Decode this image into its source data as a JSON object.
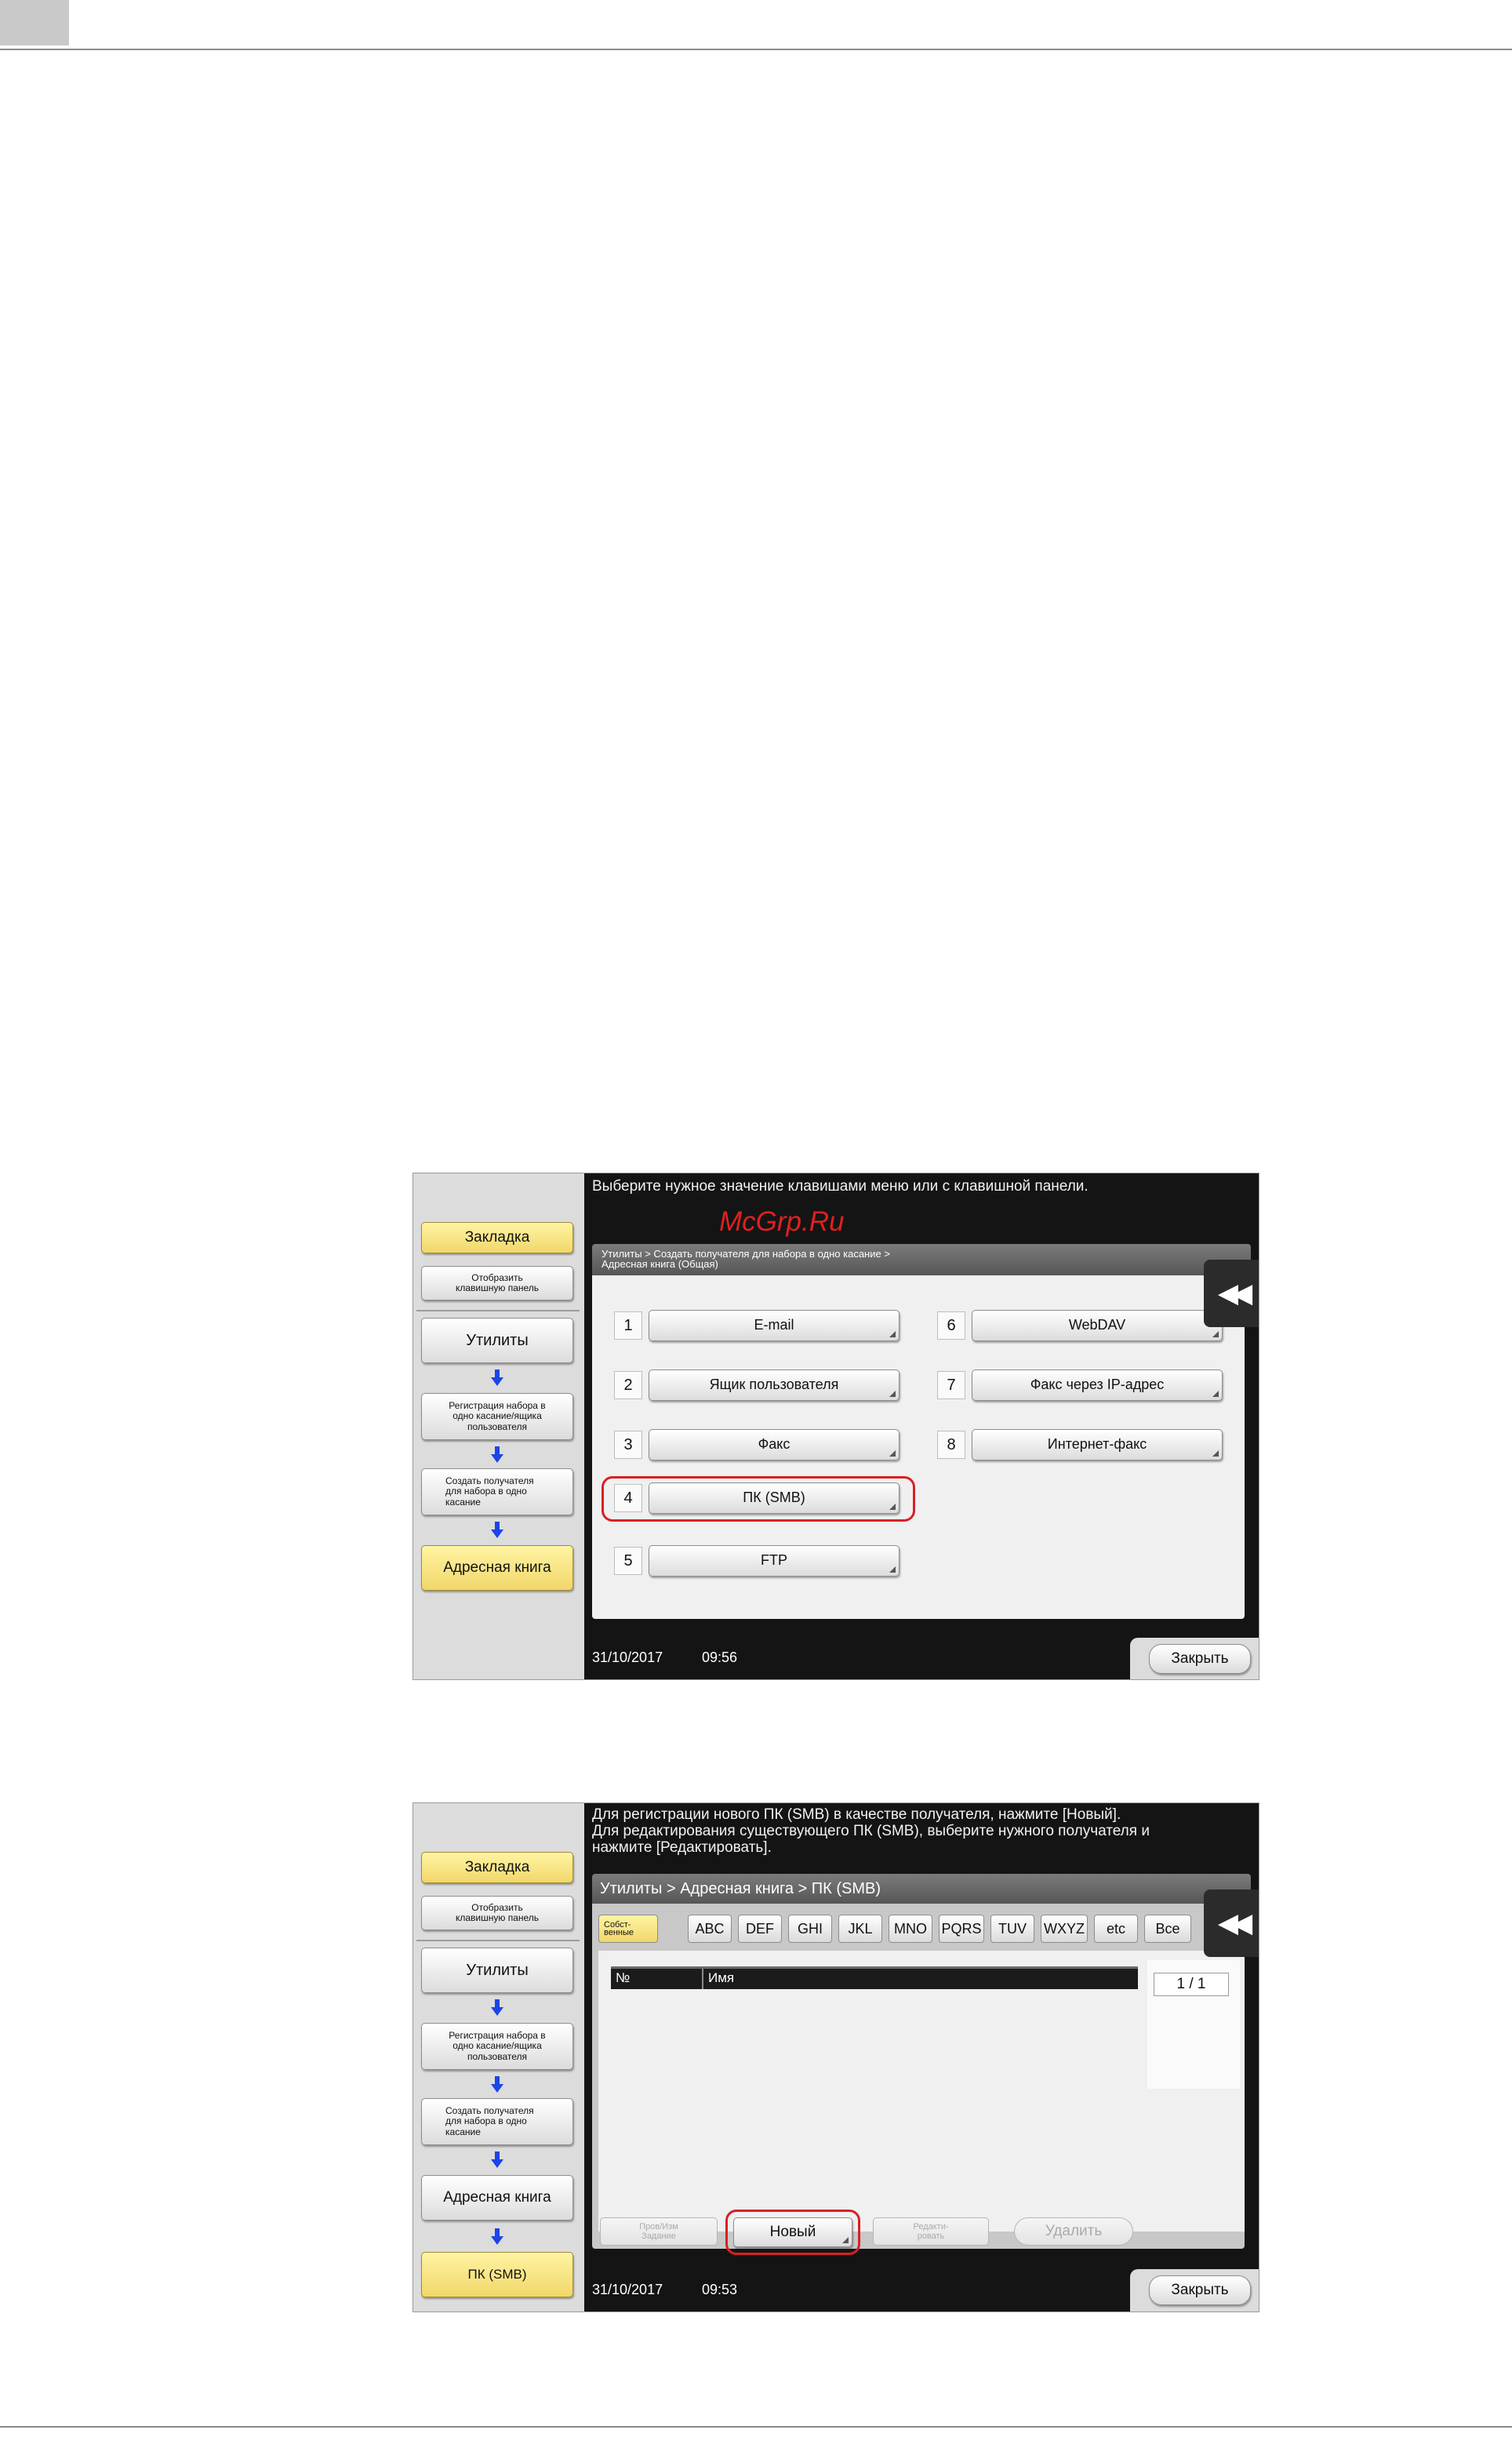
{
  "screen1": {
    "instruction": "Выберите нужное значение клавишами меню или с клавишной панели.",
    "watermark": "McGrp.Ru",
    "breadcrumb_line1": "Утилиты > Создать получателя для набора в одно касание >",
    "breadcrumb_line2": "Адресная книга (Общая)",
    "sidebar": {
      "bookmark": "Закладка",
      "show_keypad": "Отобразить клавишную панель",
      "utilities": "Утилиты",
      "one_touch_registration": "Регистрация набора в одно касание/ящика пользователя",
      "create_recipient": "Создать получателя для набора в одно касание",
      "address_book": "Адресная книга"
    },
    "items": [
      {
        "num": "1",
        "label": "E-mail"
      },
      {
        "num": "2",
        "label": "Ящик пользователя"
      },
      {
        "num": "3",
        "label": "Факс"
      },
      {
        "num": "4",
        "label": "ПК (SMB)"
      },
      {
        "num": "5",
        "label": "FTP"
      },
      {
        "num": "6",
        "label": "WebDAV"
      },
      {
        "num": "7",
        "label": "Факс через IP-адрес"
      },
      {
        "num": "8",
        "label": "Интернет-факс"
      }
    ],
    "date": "31/10/2017",
    "time": "09:56",
    "close": "Закрыть"
  },
  "screen2": {
    "instruction_line1": "Для регистрации нового ПК (SMB) в качестве получателя, нажмите [Новый].",
    "instruction_line2": "Для редактирования существующего ПК (SMB), выберите нужного получателя и",
    "instruction_line3": "нажмите [Редактировать].",
    "breadcrumb": "Утилиты > Адресная книга > ПК (SMB)",
    "sidebar": {
      "bookmark": "Закладка",
      "show_keypad": "Отобразить клавишную панель",
      "utilities": "Утилиты",
      "one_touch_registration": "Регистрация набора в одно касание/ящика пользователя",
      "create_recipient": "Создать получателя для набора в одно касание",
      "address_book": "Адресная книга",
      "pc_smb": "ПК (SMB)"
    },
    "tabs": [
      "Собст-венные",
      "ABC",
      "DEF",
      "GHI",
      "JKL",
      "MNO",
      "PQRS",
      "TUV",
      "WXYZ",
      "etc",
      "Все"
    ],
    "col_no": "№",
    "col_name": "Имя",
    "page_indicator": "1 / 1",
    "btn_check_job": "Пров/Изм Задание",
    "btn_new": "Новый",
    "btn_edit": "Редакти-ровать",
    "btn_delete": "Удалить",
    "date": "31/10/2017",
    "time": "09:53",
    "close": "Закрыть"
  },
  "colors": {
    "highlight": "#d91f24",
    "yellow_button": "#f1d76a",
    "arrow": "#1b45e6",
    "screen_black": "#141414"
  }
}
